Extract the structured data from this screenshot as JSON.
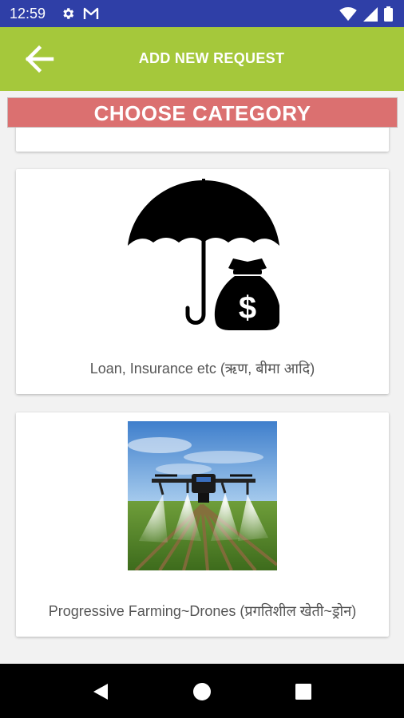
{
  "status_bar": {
    "time": "12:59",
    "left_icons": [
      "gear-icon",
      "gmail-icon"
    ],
    "right_icons": [
      "wifi-icon",
      "cell-signal-icon",
      "battery-icon"
    ]
  },
  "app_bar": {
    "title": "ADD NEW REQUEST",
    "back_icon": "arrow-back-icon",
    "color": "#a5c83b"
  },
  "banner": {
    "text": "CHOOSE CATEGORY",
    "color": "#db7070"
  },
  "categories": [
    {
      "label": "Loan, Insurance etc (ऋण, बीमा आदि)",
      "image": "umbrella-money-bag-icon"
    },
    {
      "label": "Progressive Farming~Drones (प्रगतिशील खेती~ड्रोन)",
      "image": "drone-spraying-field-photo"
    }
  ],
  "nav_bar": {
    "buttons": [
      "back-triangle-icon",
      "home-circle-icon",
      "recents-square-icon"
    ]
  }
}
